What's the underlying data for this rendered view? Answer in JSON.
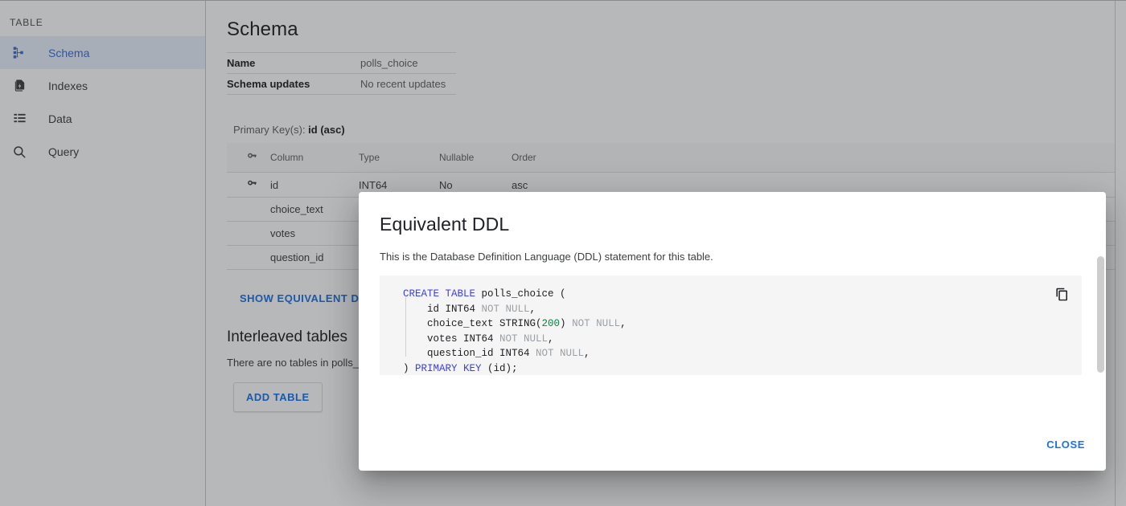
{
  "sidebar": {
    "caption": "TABLE",
    "items": [
      {
        "label": "Schema",
        "icon": "schema-icon",
        "active": true
      },
      {
        "label": "Indexes",
        "icon": "indexes-icon",
        "active": false
      },
      {
        "label": "Data",
        "icon": "data-icon",
        "active": false
      },
      {
        "label": "Query",
        "icon": "search-icon",
        "active": false
      }
    ]
  },
  "main": {
    "title": "Schema",
    "details": [
      {
        "key": "Name",
        "value": "polls_choice"
      },
      {
        "key": "Schema updates",
        "value": "No recent updates"
      }
    ],
    "primary_key_prefix": "Primary Key(s): ",
    "primary_key_value": "id (asc)",
    "columns_table": {
      "headers": [
        "",
        "Column",
        "Type",
        "Nullable",
        "Order"
      ],
      "rows": [
        {
          "key": true,
          "column": "id",
          "type": "INT64",
          "nullable": "No",
          "order": "asc"
        },
        {
          "key": false,
          "column": "choice_text",
          "type": "",
          "nullable": "",
          "order": ""
        },
        {
          "key": false,
          "column": "votes",
          "type": "",
          "nullable": "",
          "order": ""
        },
        {
          "key": false,
          "column": "question_id",
          "type": "",
          "nullable": "",
          "order": ""
        }
      ]
    },
    "show_ddl_label": "SHOW EQUIVALENT DDL",
    "interleaved": {
      "title": "Interleaved tables",
      "text": "There are no tables in polls_",
      "add_button": "ADD TABLE"
    }
  },
  "dialog": {
    "title": "Equivalent DDL",
    "subtitle": "This is the Database Definition Language (DDL) statement for this table.",
    "copy_icon": "copy-icon",
    "close_label": "CLOSE",
    "ddl_lines": [
      [
        {
          "t": "CREATE TABLE ",
          "c": "kw"
        },
        {
          "t": "polls_choice (",
          "c": ""
        }
      ],
      [
        {
          "t": "    id INT64 ",
          "c": ""
        },
        {
          "t": "NOT NULL",
          "c": "nn"
        },
        {
          "t": ",",
          "c": ""
        }
      ],
      [
        {
          "t": "    choice_text STRING(",
          "c": ""
        },
        {
          "t": "200",
          "c": "num"
        },
        {
          "t": ") ",
          "c": ""
        },
        {
          "t": "NOT NULL",
          "c": "nn"
        },
        {
          "t": ",",
          "c": ""
        }
      ],
      [
        {
          "t": "    votes INT64 ",
          "c": ""
        },
        {
          "t": "NOT NULL",
          "c": "nn"
        },
        {
          "t": ",",
          "c": ""
        }
      ],
      [
        {
          "t": "    question_id INT64 ",
          "c": ""
        },
        {
          "t": "NOT NULL",
          "c": "nn"
        },
        {
          "t": ",",
          "c": ""
        }
      ],
      [
        {
          "t": ") ",
          "c": ""
        },
        {
          "t": "PRIMARY KEY ",
          "c": "kw"
        },
        {
          "t": "(id);",
          "c": ""
        }
      ]
    ]
  },
  "colors": {
    "accent": "#1a73e8",
    "active_bg": "#e8f0fe",
    "keyword": "#3c40e8",
    "nullable": "#9aa0a6",
    "number": "#0b8043",
    "scrim": "rgba(32,33,36,.32)"
  }
}
